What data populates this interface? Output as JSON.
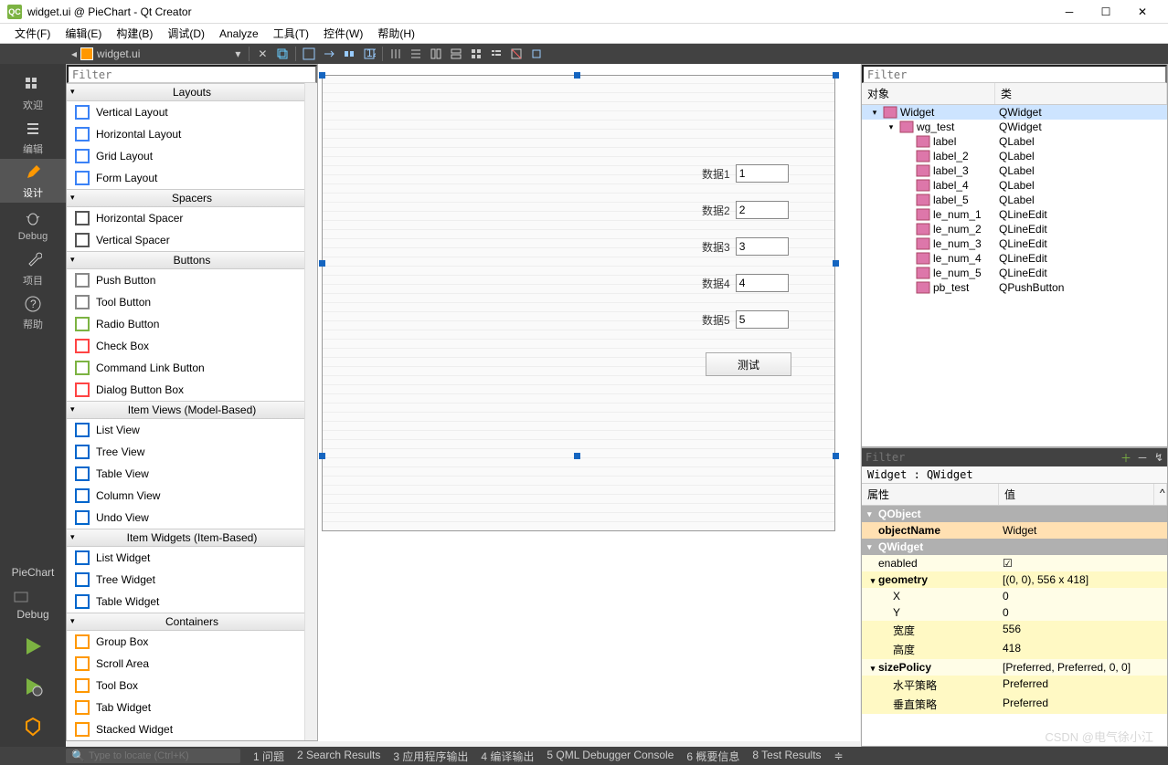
{
  "window": {
    "title": "widget.ui @ PieChart - Qt Creator",
    "logo": "QC"
  },
  "menu": [
    "文件(F)",
    "编辑(E)",
    "构建(B)",
    "调试(D)",
    "Analyze",
    "工具(T)",
    "控件(W)",
    "帮助(H)"
  ],
  "filetab": {
    "name": "widget.ui"
  },
  "leftmodes": [
    {
      "label": "欢迎",
      "icon": "grid"
    },
    {
      "label": "编辑",
      "icon": "edit"
    },
    {
      "label": "设计",
      "icon": "pencil",
      "active": true
    },
    {
      "label": "Debug",
      "icon": "bug"
    },
    {
      "label": "项目",
      "icon": "wrench"
    },
    {
      "label": "帮助",
      "icon": "help"
    }
  ],
  "kit": {
    "name": "PieChart",
    "mode": "Debug"
  },
  "widgetbox": {
    "filter": "Filter",
    "categories": [
      {
        "name": "Layouts",
        "items": [
          "Vertical Layout",
          "Horizontal Layout",
          "Grid Layout",
          "Form Layout"
        ]
      },
      {
        "name": "Spacers",
        "items": [
          "Horizontal Spacer",
          "Vertical Spacer"
        ]
      },
      {
        "name": "Buttons",
        "items": [
          "Push Button",
          "Tool Button",
          "Radio Button",
          "Check Box",
          "Command Link Button",
          "Dialog Button Box"
        ]
      },
      {
        "name": "Item Views (Model-Based)",
        "items": [
          "List View",
          "Tree View",
          "Table View",
          "Column View",
          "Undo View"
        ]
      },
      {
        "name": "Item Widgets (Item-Based)",
        "items": [
          "List Widget",
          "Tree Widget",
          "Table Widget"
        ]
      },
      {
        "name": "Containers",
        "items": [
          "Group Box",
          "Scroll Area",
          "Tool Box",
          "Tab Widget",
          "Stacked Widget"
        ]
      }
    ]
  },
  "form": {
    "rows": [
      {
        "label": "数据1",
        "value": "1"
      },
      {
        "label": "数据2",
        "value": "2"
      },
      {
        "label": "数据3",
        "value": "3"
      },
      {
        "label": "数据4",
        "value": "4"
      },
      {
        "label": "数据5",
        "value": "5"
      }
    ],
    "button": "测试"
  },
  "inspector": {
    "filter": "Filter",
    "col_object": "对象",
    "col_class": "类",
    "tree": [
      {
        "name": "Widget",
        "class": "QWidget",
        "indent": 0,
        "sel": true,
        "expand": true
      },
      {
        "name": "wg_test",
        "class": "QWidget",
        "indent": 1,
        "expand": true
      },
      {
        "name": "label",
        "class": "QLabel",
        "indent": 2
      },
      {
        "name": "label_2",
        "class": "QLabel",
        "indent": 2
      },
      {
        "name": "label_3",
        "class": "QLabel",
        "indent": 2
      },
      {
        "name": "label_4",
        "class": "QLabel",
        "indent": 2
      },
      {
        "name": "label_5",
        "class": "QLabel",
        "indent": 2
      },
      {
        "name": "le_num_1",
        "class": "QLineEdit",
        "indent": 2
      },
      {
        "name": "le_num_2",
        "class": "QLineEdit",
        "indent": 2
      },
      {
        "name": "le_num_3",
        "class": "QLineEdit",
        "indent": 2
      },
      {
        "name": "le_num_4",
        "class": "QLineEdit",
        "indent": 2
      },
      {
        "name": "le_num_5",
        "class": "QLineEdit",
        "indent": 2
      },
      {
        "name": "pb_test",
        "class": "QPushButton",
        "indent": 2
      }
    ]
  },
  "props": {
    "filter": "Filter",
    "objpath": "Widget : QWidget",
    "col_prop": "属性",
    "col_val": "值",
    "groups": [
      {
        "title": "QObject",
        "rows": [
          {
            "n": "objectName",
            "v": "Widget",
            "bold": true,
            "cls": "orange"
          }
        ]
      },
      {
        "title": "QWidget",
        "rows": [
          {
            "n": "enabled",
            "v": "☑",
            "cls": "yellow2"
          },
          {
            "n": "geometry",
            "v": "[(0, 0), 556 x 418]",
            "parent": true,
            "cls": "yellow"
          },
          {
            "n": "X",
            "v": "0",
            "sub": true,
            "cls": "yellow2"
          },
          {
            "n": "Y",
            "v": "0",
            "sub": true,
            "cls": "yellow2"
          },
          {
            "n": "宽度",
            "v": "556",
            "sub": true,
            "cls": "yellow"
          },
          {
            "n": "高度",
            "v": "418",
            "sub": true,
            "cls": "yellow"
          },
          {
            "n": "sizePolicy",
            "v": "[Preferred, Preferred, 0, 0]",
            "parent": true,
            "cls": "yellow2"
          },
          {
            "n": "水平策略",
            "v": "Preferred",
            "sub": true,
            "cls": "yellow"
          },
          {
            "n": "垂直策略",
            "v": "Preferred",
            "sub": true,
            "cls": "yellow"
          }
        ]
      }
    ]
  },
  "status": {
    "locate_ph": "Type to locate (Ctrl+K)",
    "items": [
      "1 问题",
      "2 Search Results",
      "3 应用程序输出",
      "4 编译输出",
      "5 QML Debugger Console",
      "6 概要信息",
      "8 Test Results"
    ]
  },
  "watermark": "CSDN @电气徐小江"
}
